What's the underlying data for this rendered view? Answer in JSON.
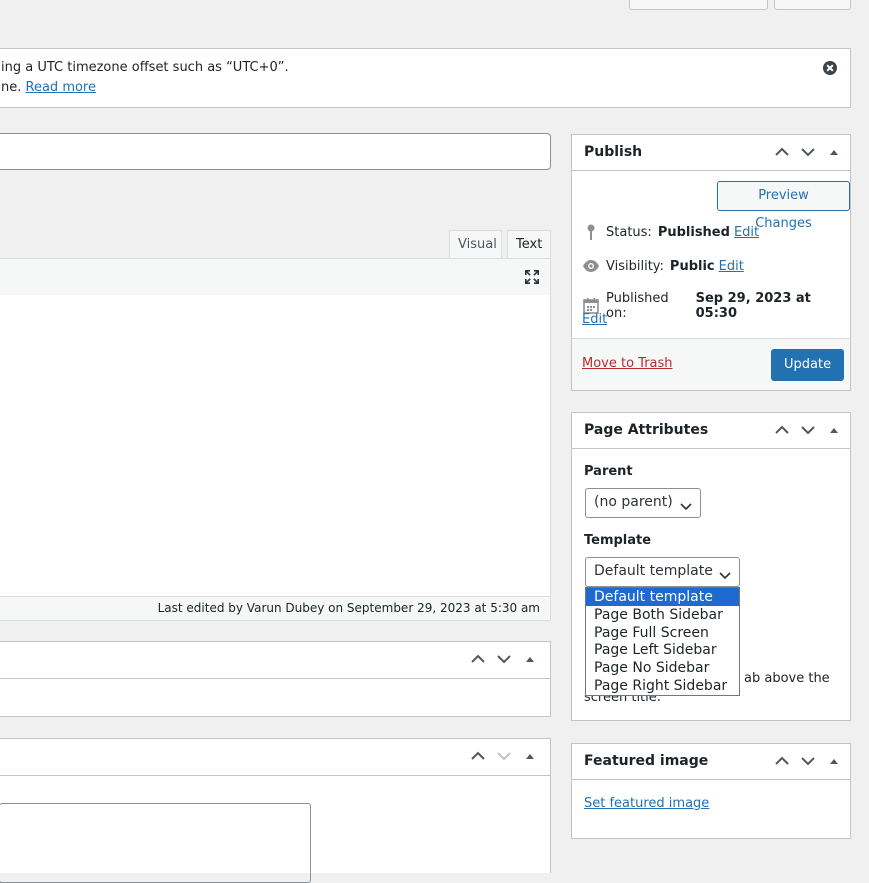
{
  "notice": {
    "line1": "ing a UTC timezone offset such as “UTC+0”.",
    "line2_prefix": "ne. ",
    "read_more": "Read more"
  },
  "editor": {
    "tab_visual": "Visual",
    "tab_text": "Text",
    "last_edited": "Last edited by Varun Dubey on September 29, 2023 at 5:30 am"
  },
  "publish": {
    "title": "Publish",
    "preview_button": "Preview Changes",
    "status_label": "Status:",
    "status_value": "Published",
    "visibility_label": "Visibility:",
    "visibility_value": "Public",
    "published_on_label": "Published on:",
    "published_on_value": "Sep 29, 2023 at 05:30",
    "edit": "Edit",
    "trash": "Move to Trash",
    "update": "Update"
  },
  "page_attributes": {
    "title": "Page Attributes",
    "parent_label": "Parent",
    "parent_value": "(no parent)",
    "template_label": "Template",
    "template_value": "Default template",
    "template_options": [
      "Default template",
      "Page Both Sidebar",
      "Page Full Screen",
      "Page Left Sidebar",
      "Page No Sidebar",
      "Page Right Sidebar"
    ],
    "help_line1": "ab above the",
    "help_line2": "screen title."
  },
  "featured_image": {
    "title": "Featured image",
    "set_link": "Set featured image"
  },
  "colors": {
    "accent": "#2271b1",
    "trash": "#b32d2e",
    "selected_option": "#1e69d2"
  }
}
